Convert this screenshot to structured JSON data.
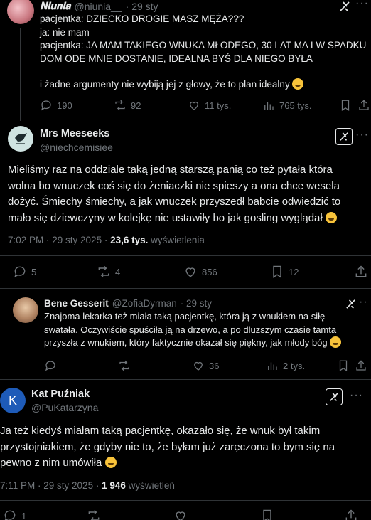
{
  "tweet1": {
    "name": "𝐍𝐢𝐮𝐧𝐢𝐚",
    "handle": "@niunia__",
    "time": "· 29 sty",
    "lines": [
      "pacjentka: DZIECKO DROGIE MASZ MĘŻA???",
      "ja: nie mam",
      "pacjentka: JA MAM TAKIEGO WNUKA MŁODEGO, 30 LAT MA I W SPADKU",
      "DOM ODE MNIE DOSTANIE, IDEALNA BYŚ DLA NIEGO BYŁA"
    ],
    "last_line": "i żadne argumenty nie wybiją jej z głowy, że to plan idealny",
    "replies": "190",
    "retweets": "92",
    "likes": "11 tys.",
    "views": "765 tys."
  },
  "tweet2": {
    "name": "Mrs Meeseeks",
    "handle": "@niechcemisiee",
    "lines": [
      "Mieliśmy raz na oddziale taką jedną starszą panią co też pytała która",
      "wolna bo wnuczek coś się do żeniaczki nie spieszy a ona chce wesela",
      "dożyć. Śmiechy śmiechy, a jak wnuczek przyszedł babcie odwiedzić to",
      "mało się dziewczyny w kolejkę nie ustawiły bo jak gosling wyglądał"
    ],
    "meta_time": "7:02 PM · 29 sty 2025 ·",
    "meta_views": "23,6 tys.",
    "meta_views_label": "wyświetlenia",
    "replies": "5",
    "retweets": "4",
    "likes": "856",
    "bookmarks": "12"
  },
  "tweet3": {
    "name": "Bene Gesserit",
    "handle": "@ZofiaDyrman",
    "time": "· 29 sty",
    "lines": [
      "Znajoma lekarka też miała taką pacjentkę, która ją z wnukiem na siłę",
      "swatała. Oczywiście spuściła ją na drzewo, a po dluzszym czasie tamta",
      "przyszła z wnukiem, który faktycznie okazał się piękny, jak młody bóg"
    ],
    "likes": "36",
    "views": "2 tys."
  },
  "tweet4": {
    "name": "Kat Puźniak",
    "handle": "@PuKatarzyna",
    "avatar_letter": "K",
    "lines": [
      "Ja też kiedyś miałam taką pacjentkę, okazało się, że wnuk był takim",
      "przystojniakiem, że gdyby nie to, że byłam już zaręczona to bym się na",
      "pewno z nim umówiła"
    ],
    "meta_time": "7:11 PM · 29 sty 2025 ·",
    "meta_views": "1 946",
    "meta_views_label": "wyświetleń",
    "replies": "1"
  }
}
